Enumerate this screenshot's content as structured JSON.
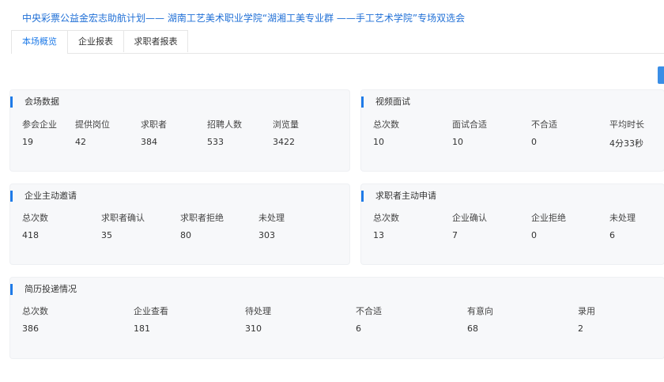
{
  "page": {
    "title": "中央彩票公益金宏志助航计划—— 湖南工艺美术职业学院“湖湘工美专业群 ——手工艺术学院”专场双选会"
  },
  "tabs": [
    {
      "label": "本场概览",
      "active": true
    },
    {
      "label": "企业报表",
      "active": false
    },
    {
      "label": "求职者报表",
      "active": false
    }
  ],
  "colors": {
    "accent": "#1f7be8",
    "card_bg": "#f7f8fa",
    "title": "#1f6fd6"
  },
  "venue_data": {
    "title": "会场数据",
    "stats": [
      {
        "label": "参会企业",
        "value": "19"
      },
      {
        "label": "提供岗位",
        "value": "42"
      },
      {
        "label": "求职者",
        "value": "384"
      },
      {
        "label": "招聘人数",
        "value": "533"
      },
      {
        "label": "浏览量",
        "value": "3422"
      }
    ]
  },
  "video_interview": {
    "title": "视频面试",
    "stats": [
      {
        "label": "总次数",
        "value": "10"
      },
      {
        "label": "面试合适",
        "value": "10"
      },
      {
        "label": "不合适",
        "value": "0"
      },
      {
        "label": "平均时长",
        "value": "4分33秒"
      }
    ]
  },
  "company_invite": {
    "title": "企业主动邀请",
    "stats": [
      {
        "label": "总次数",
        "value": "418"
      },
      {
        "label": "求职者确认",
        "value": "35"
      },
      {
        "label": "求职者拒绝",
        "value": "80"
      },
      {
        "label": "未处理",
        "value": "303"
      }
    ]
  },
  "seeker_apply": {
    "title": "求职者主动申请",
    "stats": [
      {
        "label": "总次数",
        "value": "13"
      },
      {
        "label": "企业确认",
        "value": "7"
      },
      {
        "label": "企业拒绝",
        "value": "0"
      },
      {
        "label": "未处理",
        "value": "6"
      }
    ]
  },
  "resume_delivery": {
    "title": "简历投递情况",
    "stats": [
      {
        "label": "总次数",
        "value": "386"
      },
      {
        "label": "企业查看",
        "value": "181"
      },
      {
        "label": "待处理",
        "value": "310"
      },
      {
        "label": "不合适",
        "value": "6"
      },
      {
        "label": "有意向",
        "value": "68"
      },
      {
        "label": "录用",
        "value": "2"
      }
    ]
  }
}
